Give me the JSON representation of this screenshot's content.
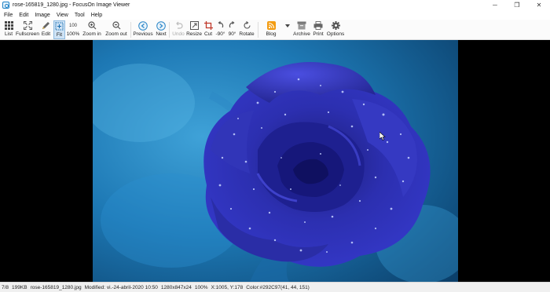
{
  "window": {
    "title": "rose-165819_1280.jpg - FocusOn Image Viewer",
    "controls": {
      "minimize": "─",
      "maximize": "❐",
      "close": "✕"
    }
  },
  "menu": [
    "File",
    "Edit",
    "Image",
    "View",
    "Tool",
    "Help"
  ],
  "toolbar": {
    "list": "List",
    "fullscreen": "Fullscreen",
    "edit": "Edit",
    "fit": "Fit",
    "hundred_icon": "100",
    "hundred": "100%",
    "zoom_in": "Zoom in",
    "zoom_out": "Zoom out",
    "previous": "Previous",
    "next": "Next",
    "undo": "Undo",
    "resize": "Resize",
    "cut": "Cut",
    "rotate_left": "-90°",
    "rotate_right": "90°",
    "rotate": "Rotate",
    "blog": "Blog",
    "archive": "Archive",
    "print": "Print",
    "options": "Options"
  },
  "status": {
    "position": "7/8",
    "size": "199KB",
    "filename": "rose-165819_1280.jpg",
    "modified": "Modified: vi.-24-abril-2020 10:50",
    "dimensions": "1280x847x24",
    "zoom": "100%",
    "coords": "X:1005, Y:178",
    "color": "Color:#292C97(41, 44, 151)"
  },
  "colors": {
    "accent": "#1a7fc4",
    "rose": "#292C97",
    "background": "#000000"
  }
}
